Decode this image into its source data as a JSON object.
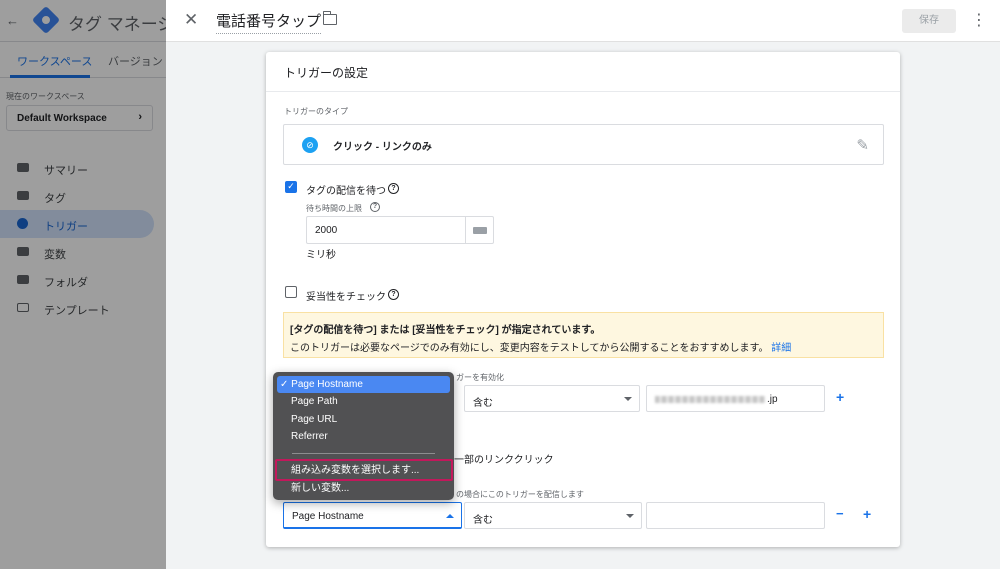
{
  "background": {
    "app_title": "タグ マネージャー",
    "tabs": [
      "ワークスペース",
      "バージョン"
    ],
    "workspace_label": "現在のワークスペース",
    "workspace_name": "Default Workspace",
    "nav": [
      {
        "label": "サマリー",
        "icon": "summary-icon"
      },
      {
        "label": "タグ",
        "icon": "tag-icon"
      },
      {
        "label": "トリガー",
        "icon": "trigger-icon",
        "active": true
      },
      {
        "label": "変数",
        "icon": "variables-icon"
      },
      {
        "label": "フォルダ",
        "icon": "folder-icon"
      },
      {
        "label": "テンプレート",
        "icon": "template-icon"
      }
    ]
  },
  "sheet": {
    "title": "電話番号タップ",
    "save_label": "保存"
  },
  "card": {
    "title": "トリガーの設定",
    "type_label": "トリガーのタイプ",
    "trigger_type": "クリック - リンクのみ",
    "wait_tags": {
      "label": "タグの配信を待つ",
      "checked": true
    },
    "wait_limit_label": "待ち時間の上限",
    "wait_limit_value": "2000",
    "ms_label": "ミリ秒",
    "validate": {
      "label": "妥当性をチェック",
      "checked": false
    },
    "warning": {
      "line1": "[タグの配信を待つ] または [妥当性をチェック] が指定されています。",
      "line2": "このトリガーは必要なページでのみ有効にし、変更内容をテストしてから公開することをおすすめします。",
      "link": "詳細"
    },
    "enable_label_partial": "ガーを有効化",
    "condition1": {
      "operator": "含む",
      "value_suffix": ".jp"
    },
    "some_clicks_partial": "一部のリンククリック",
    "fire_label_partial": "の場合にこのトリガーを配信します",
    "condition2": {
      "variable": "Page Hostname",
      "operator": "含む",
      "value": ""
    }
  },
  "dropdown": {
    "items": [
      "Page Hostname",
      "Page Path",
      "Page URL",
      "Referrer"
    ],
    "selected_index": 0,
    "extra_items": [
      "組み込み変数を選択します...",
      "新しい変数..."
    ],
    "highlight_color": "#c2185b"
  },
  "colors": {
    "accent": "#1a73e8",
    "warning_bg": "#fef7e0",
    "highlight": "#c2185b"
  }
}
